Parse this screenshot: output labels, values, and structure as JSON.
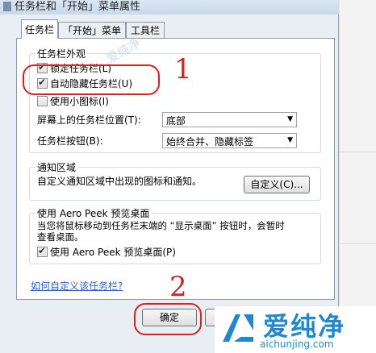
{
  "window": {
    "title": "任务栏和「开始」菜单属性"
  },
  "tabs": [
    {
      "label": "任务栏",
      "active": true
    },
    {
      "label": "「开始」菜单",
      "active": false
    },
    {
      "label": "工具栏",
      "active": false
    }
  ],
  "appearance": {
    "legend": "任务栏外观",
    "lock_taskbar": {
      "label": "锁定任务栏(L)",
      "checked": true
    },
    "auto_hide": {
      "label": "自动隐藏任务栏(U)",
      "checked": true
    },
    "small_icons": {
      "label": "使用小图标(I)",
      "checked": false
    },
    "position": {
      "label": "屏幕上的任务栏位置(T):",
      "value": "底部"
    },
    "buttons": {
      "label": "任务栏按钮(B):",
      "value": "始终合并、隐藏标签"
    }
  },
  "notification": {
    "legend": "通知区域",
    "description": "自定义通知区域中出现的图标和通知。",
    "customize_label": "自定义(C)..."
  },
  "aero_peek": {
    "legend": "使用 Aero Peek 预览桌面",
    "description_line1": "当您将鼠标移动到任务栏末端的 “显示桌面” 按钮时，会暂时",
    "description_line2": "查看桌面。",
    "checkbox": {
      "label": "使用 Aero Peek 预览桌面(P)",
      "checked": true
    }
  },
  "help_link": "如何自定义该任务栏?",
  "ok_label": "确定",
  "annotations": {
    "step1": "1",
    "step2": "2"
  },
  "watermark": {
    "title": "爱纯净",
    "url": "aichunjing.com",
    "stamp": "爱纯净"
  },
  "colors": {
    "annotation": "#e0201a",
    "link": "#2d5fd2",
    "brand": "#1f88d0"
  }
}
